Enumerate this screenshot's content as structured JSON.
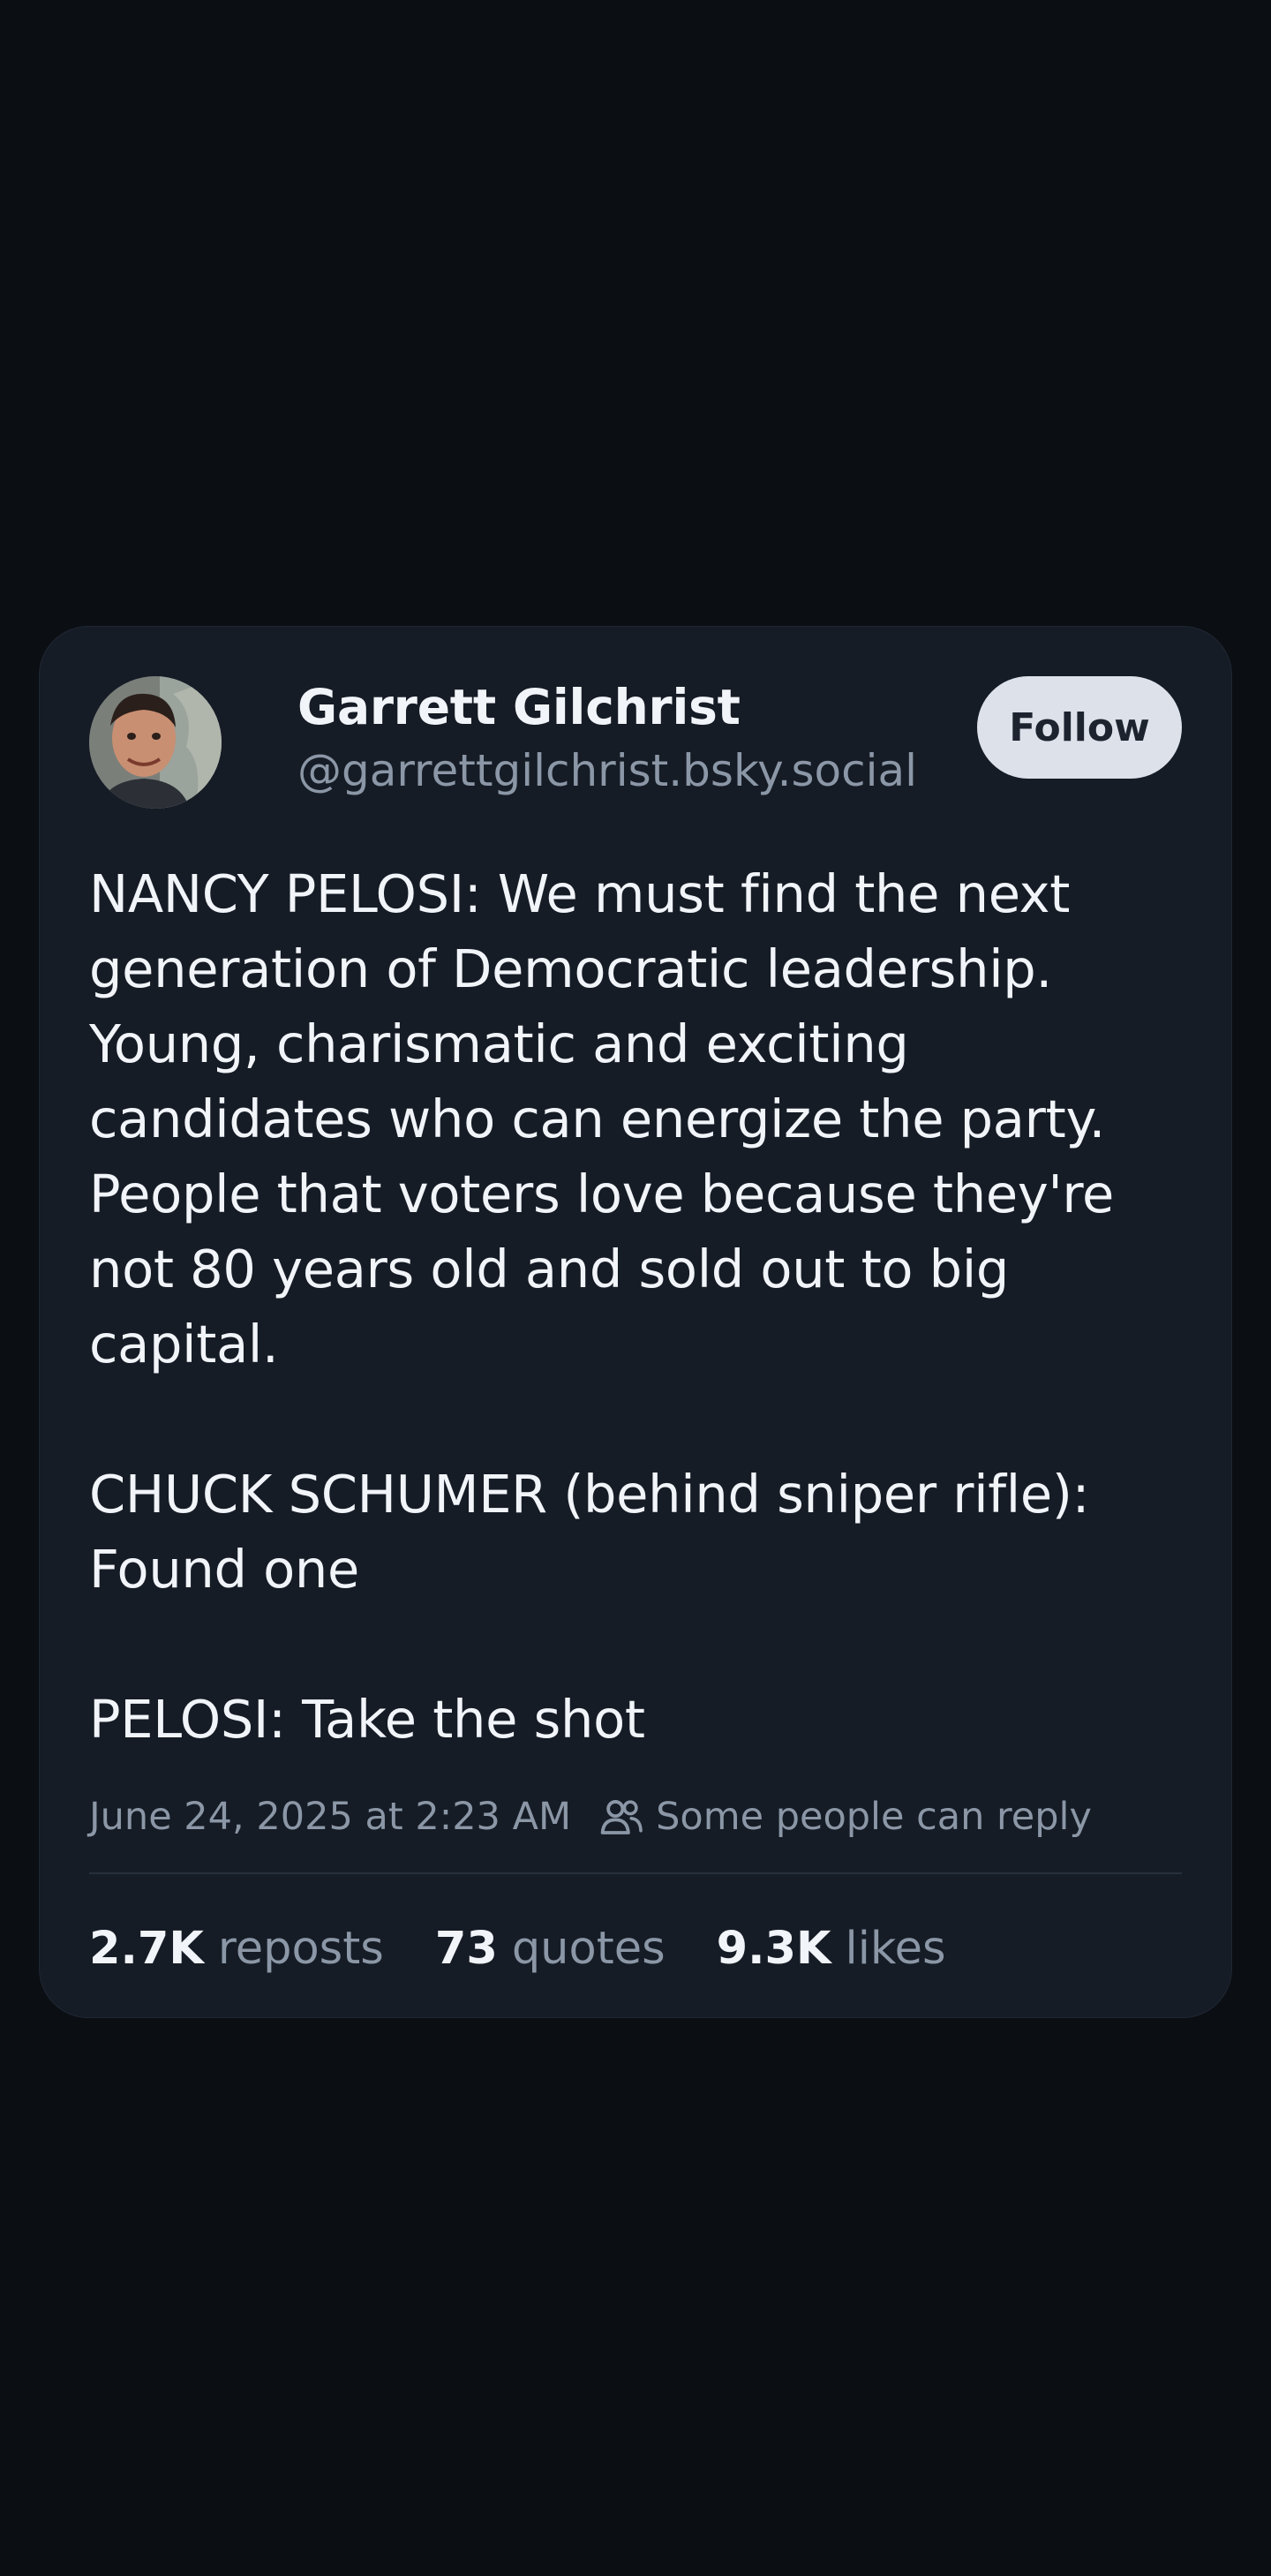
{
  "post": {
    "author": {
      "display_name": "Garrett Gilchrist",
      "handle": "@garrettgilchrist.bsky.social"
    },
    "follow_label": "Follow",
    "text": "NANCY PELOSI: We must find the next generation of Democratic leadership. Young, charismatic and exciting candidates who can energize the party. People that voters love because they're not 80 years old and sold out to big capital.\n\nCHUCK SCHUMER (behind sniper rifle): Found one\n\nPELOSI: Take the shot",
    "timestamp": "June 24, 2025 at 2:23 AM",
    "reply_restriction": "Some people can reply",
    "reply_icon": "people-icon",
    "stats": {
      "reposts_count": "2.7K",
      "reposts_label": "reposts",
      "quotes_count": "73",
      "quotes_label": "quotes",
      "likes_count": "9.3K",
      "likes_label": "likes"
    }
  },
  "colors": {
    "page_background": "#0b0e13",
    "card_background": "#161c26",
    "primary_text": "#f1f4f8",
    "secondary_text": "#8b97a6",
    "follow_button_bg": "#dde2ea"
  }
}
